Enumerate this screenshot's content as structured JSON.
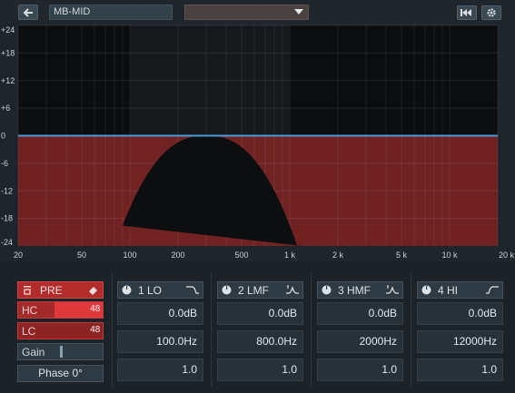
{
  "toolbar": {
    "preset_name": "MB-MID",
    "dropdown_value": "",
    "icons": [
      "back-arrow-icon",
      "transport-rewind-icon",
      "gear-icon"
    ]
  },
  "graph": {
    "y_ticks": [
      "+24",
      "+18",
      "+12",
      "+6",
      "0",
      "-6",
      "-12",
      "-18",
      "-24"
    ],
    "x_ticks": [
      "20",
      "50",
      "100",
      "200",
      "500",
      "1 k",
      "2 k",
      "5 k",
      "10 k",
      "20 k"
    ],
    "colors": {
      "curve": "#4a9ad8",
      "fill": "#7a2424",
      "background": "#0b0d0f"
    }
  },
  "pre": {
    "label": "PRE",
    "hc_label": "HC",
    "hc_value": "48",
    "lc_label": "LC",
    "lc_value": "48",
    "gain_label": "Gain",
    "phase_label": "Phase 0°"
  },
  "bands": [
    {
      "name": "1 LO",
      "gain": "0.0dB",
      "freq": "100.0Hz",
      "q": "1.0",
      "shape": "low-shelf-icon"
    },
    {
      "name": "2 LMF",
      "gain": "0.0dB",
      "freq": "800.0Hz",
      "q": "1.0",
      "shape": "peak-icon"
    },
    {
      "name": "3 HMF",
      "gain": "0.0dB",
      "freq": "2000Hz",
      "q": "1.0",
      "shape": "peak-icon"
    },
    {
      "name": "4 HI",
      "gain": "0.0dB",
      "freq": "12000Hz",
      "q": "1.0",
      "shape": "high-shelf-icon"
    }
  ]
}
